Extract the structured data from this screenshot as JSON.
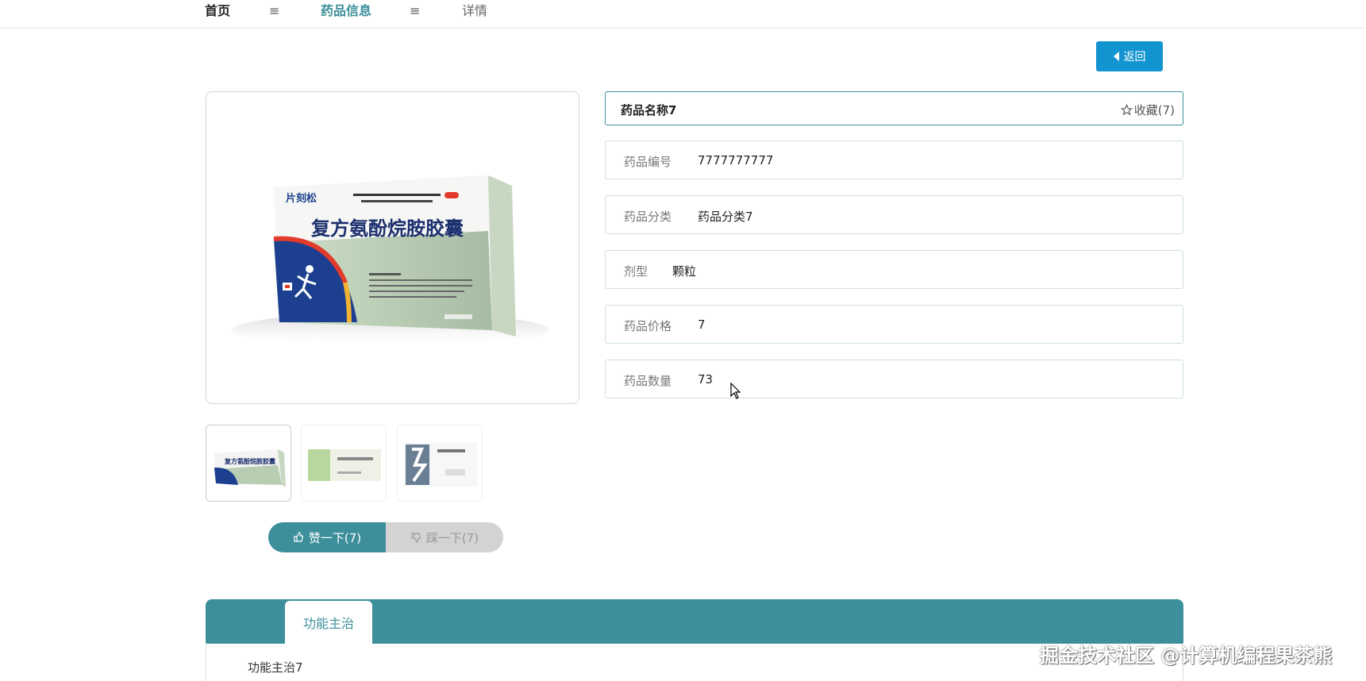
{
  "breadcrumb": {
    "home": "首页",
    "separator": "≡",
    "section": "药品信息",
    "current": "详情"
  },
  "back_button": {
    "label": "返回"
  },
  "product": {
    "name": "药品名称7",
    "favorite_label": "收藏(7)",
    "box_brand": "片刻松",
    "box_title": "复方氨酚烷胺胶囊",
    "rows": [
      {
        "label": "药品编号",
        "value": "7777777777"
      },
      {
        "label": "药品分类",
        "value": "药品分类7"
      },
      {
        "label": "剂型",
        "value": "颗粒"
      },
      {
        "label": "药品价格",
        "value": "7"
      },
      {
        "label": "药品数量",
        "value": "73"
      }
    ]
  },
  "thumbnails": [
    {
      "name": "thumb-1",
      "caption": "复方氨酚烷胺胶囊"
    },
    {
      "name": "thumb-2",
      "caption": ""
    },
    {
      "name": "thumb-3",
      "caption": ""
    }
  ],
  "vote": {
    "like_label": "赞一下(7)",
    "dislike_label": "踩一下(7)"
  },
  "tabs": [
    {
      "label": "功能主治",
      "active": true
    }
  ],
  "tab_content": "功能主治7",
  "watermark": "掘金技术社区 @计算机编程果茶熊",
  "colors": {
    "accent": "#3c8f9b",
    "back_button": "#1294d0",
    "dislike_bg": "#d3d3d3"
  }
}
